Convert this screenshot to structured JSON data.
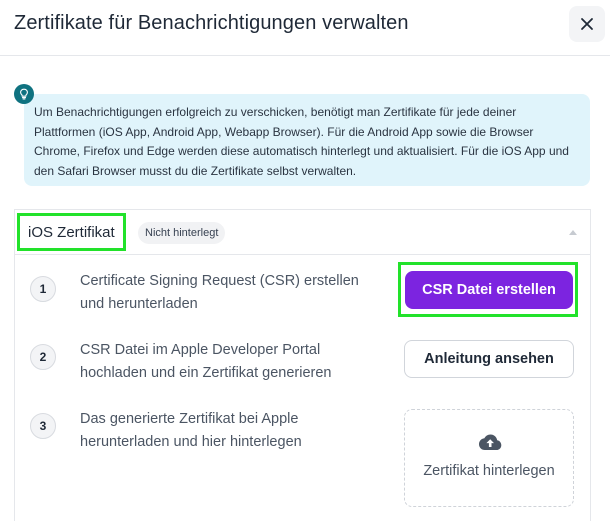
{
  "modal": {
    "title": "Zertifikate für Benachrichtigungen verwalten",
    "close_icon": "close-icon"
  },
  "info": {
    "icon": "lightbulb-icon",
    "text": "Um Benachrichtigungen erfolgreich zu verschicken, benötigt man Zertifikate für jede deiner Plattformen (iOS App, Android App, Webapp Browser). Für die Android App sowie die Browser Chrome, Firefox und Edge werden diese automatisch hinterlegt und aktualisiert. Für die iOS App und den Safari Browser musst du die Zertifikate selbst verwalten.",
    "color": "#e0f4fb"
  },
  "ios_section": {
    "title": "iOS Zertifikat",
    "status_badge": "Nicht hinterlegt",
    "collapse_icon": "chevron-up-icon",
    "steps": [
      {
        "number": "1",
        "text": "Certificate Signing Request (CSR) erstellen und herunterladen",
        "action_label": "CSR Datei erstellen"
      },
      {
        "number": "2",
        "text": "CSR Datei im Apple Developer Portal hochladen und ein Zertifikat generieren",
        "action_label": "Anleitung ansehen"
      },
      {
        "number": "3",
        "text": "Das generierte Zertifikat bei Apple herunterladen und hier hinterlegen",
        "action_label": "Zertifikat hinterlegen",
        "action_icon": "cloud-upload-icon"
      }
    ]
  },
  "colors": {
    "primary": "#7c24e0",
    "highlight": "#22e22a",
    "info_icon": "#0f7280"
  }
}
